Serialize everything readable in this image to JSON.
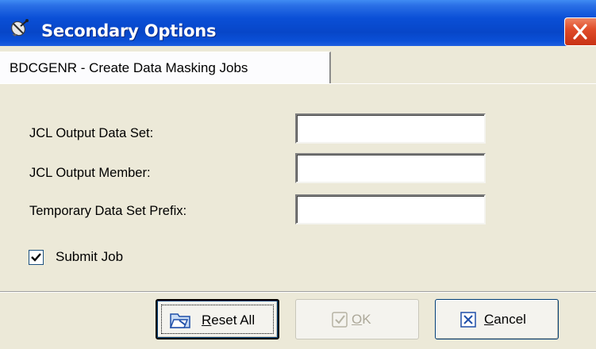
{
  "window": {
    "title": "Secondary Options",
    "title_icon": "satellite-icon"
  },
  "tab": {
    "label": "BDCGENR - Create Data Masking Jobs"
  },
  "form": {
    "fields": [
      {
        "label": "JCL Output Data Set:",
        "value": ""
      },
      {
        "label": "JCL Output Member:",
        "value": ""
      },
      {
        "label": "Temporary Data Set Prefix:",
        "value": ""
      }
    ],
    "submit_job": {
      "label": "Submit Job",
      "checked": true
    }
  },
  "buttons": {
    "reset": {
      "mnemonic": "R",
      "rest": "eset All",
      "icon": "reset-icon"
    },
    "ok": {
      "mnemonic": "O",
      "rest": "K",
      "icon": "check-icon",
      "enabled": false
    },
    "cancel": {
      "mnemonic": "C",
      "rest": "ancel",
      "icon": "cancel-x-icon"
    }
  },
  "colors": {
    "titlebar": "#0a4fd6",
    "close_button": "#e04d2a",
    "dialog_background": "#ece9d8"
  }
}
